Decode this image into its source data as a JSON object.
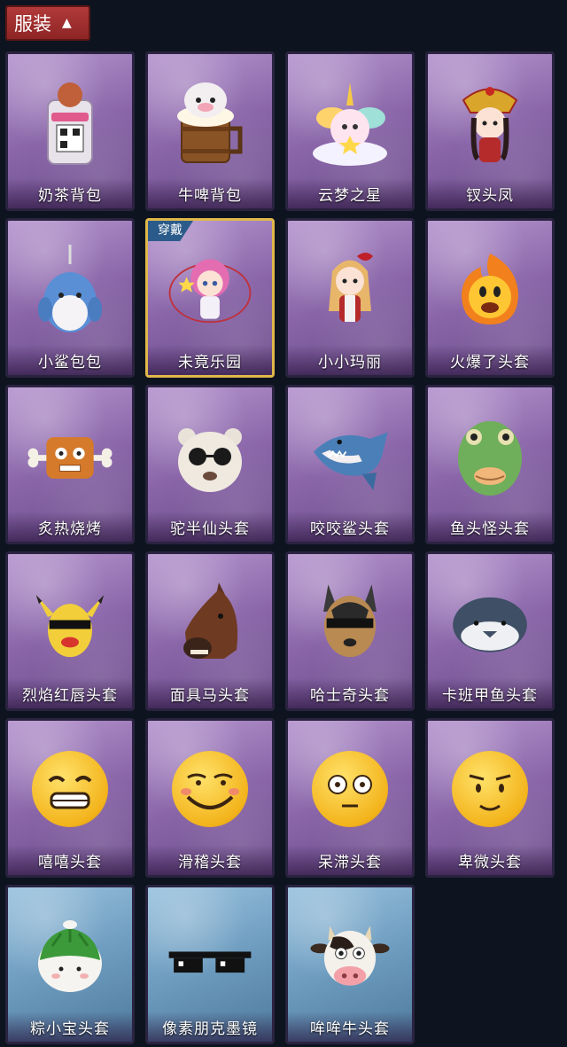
{
  "header": {
    "title": "服装"
  },
  "wear_badge": "穿戴",
  "items": [
    {
      "label": "奶茶背包",
      "theme": "purple"
    },
    {
      "label": "牛啤背包",
      "theme": "purple"
    },
    {
      "label": "云梦之星",
      "theme": "purple"
    },
    {
      "label": "钗头凤",
      "theme": "purple"
    },
    {
      "label": "小鲨包包",
      "theme": "purple"
    },
    {
      "label": "未竟乐园",
      "theme": "purple",
      "selected": true
    },
    {
      "label": "小小玛丽",
      "theme": "purple"
    },
    {
      "label": "火爆了头套",
      "theme": "purple"
    },
    {
      "label": "炙热烧烤",
      "theme": "purple"
    },
    {
      "label": "驼半仙头套",
      "theme": "purple"
    },
    {
      "label": "咬咬鲨头套",
      "theme": "purple"
    },
    {
      "label": "鱼头怪头套",
      "theme": "purple"
    },
    {
      "label": "烈焰红唇头套",
      "theme": "purple"
    },
    {
      "label": "面具马头套",
      "theme": "purple"
    },
    {
      "label": "哈士奇头套",
      "theme": "purple"
    },
    {
      "label": "卡班甲鱼头套",
      "theme": "purple"
    },
    {
      "label": "嘻嘻头套",
      "theme": "purple"
    },
    {
      "label": "滑稽头套",
      "theme": "purple"
    },
    {
      "label": "呆滞头套",
      "theme": "purple"
    },
    {
      "label": "卑微头套",
      "theme": "purple"
    },
    {
      "label": "粽小宝头套",
      "theme": "blue"
    },
    {
      "label": "像素朋克墨镜",
      "theme": "blue"
    },
    {
      "label": "哞哞牛头套",
      "theme": "blue"
    }
  ]
}
